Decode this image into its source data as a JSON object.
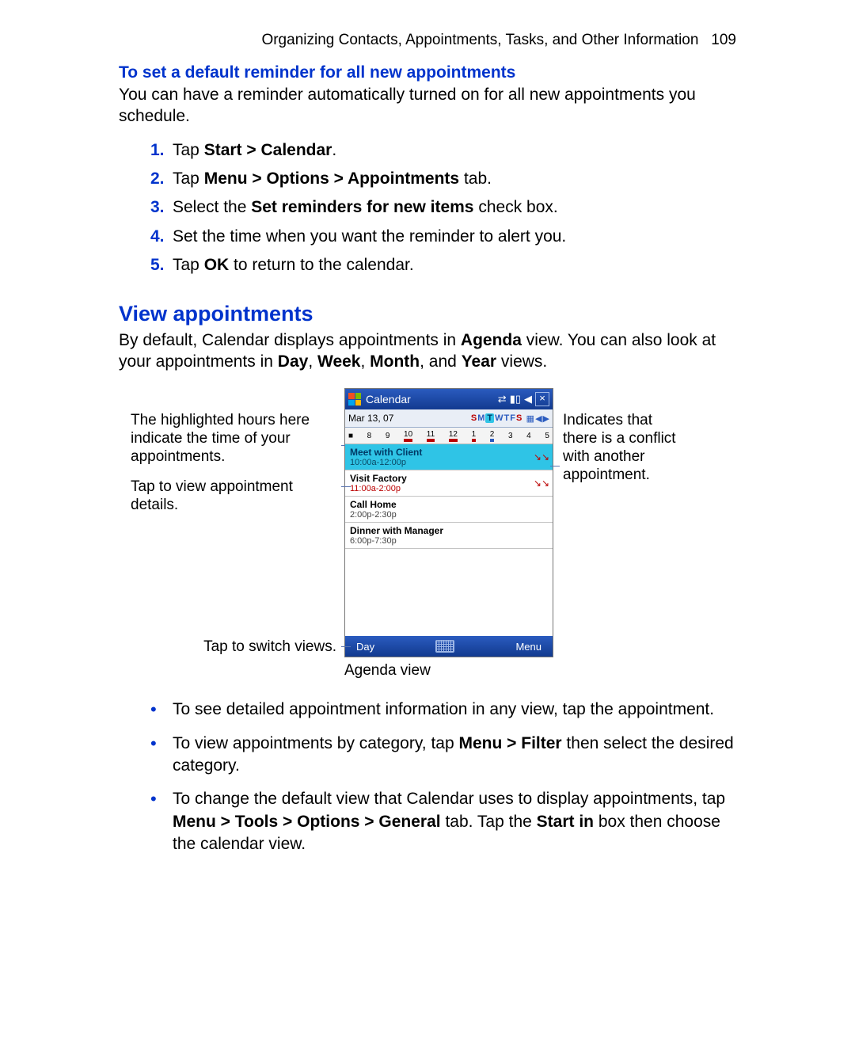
{
  "running_head": {
    "title": "Organizing Contacts, Appointments, Tasks, and Other Information",
    "page_no": "109"
  },
  "section1": {
    "title": "To set a default reminder for all new appointments",
    "intro": "You can have a reminder automatically turned on for all new appointments you schedule.",
    "steps": [
      {
        "n": "1.",
        "pre": "Tap ",
        "bold": "Start > Calendar",
        "post": "."
      },
      {
        "n": "2.",
        "pre": "Tap ",
        "bold": "Menu > Options > Appointments",
        "post": " tab."
      },
      {
        "n": "3.",
        "pre": "Select the ",
        "bold": "Set reminders for new items",
        "post": " check box."
      },
      {
        "n": "4.",
        "plain": "Set the time when you want the reminder to alert you."
      },
      {
        "n": "5.",
        "pre": "Tap ",
        "bold": "OK",
        "post": " to return to the calendar."
      }
    ]
  },
  "section2": {
    "title": "View appointments",
    "intro_a": "By default, Calendar displays appointments in ",
    "intro_b": "Agenda",
    "intro_c": " view. You can also look at your appointments in ",
    "intro_d": "Day",
    "intro_e": ", ",
    "intro_f": "Week",
    "intro_g": ", ",
    "intro_h": "Month",
    "intro_i": ", and ",
    "intro_j": "Year",
    "intro_k": " views."
  },
  "callouts": {
    "left1": "The highlighted hours here indicate the time of your appointments.",
    "left2": "Tap to view appointment details.",
    "left3": "Tap to switch views.",
    "right1": "Indicates that there is a conflict with another appointment."
  },
  "device": {
    "title": "Calendar",
    "date": "Mar 13, 07",
    "dows": [
      "S",
      "M",
      "T",
      "W",
      "T",
      "F",
      "S"
    ],
    "hours": [
      "8",
      "9",
      "10",
      "11",
      "12",
      "1",
      "2",
      "3",
      "4",
      "5"
    ],
    "appointments": [
      {
        "title": "Meet with Client",
        "time": "10:00a-12:00p",
        "active": true,
        "conflict": true
      },
      {
        "title": "Visit Factory",
        "time": "11:00a-2:00p",
        "active": false,
        "conflict": true
      },
      {
        "title": "Call Home",
        "time": "2:00p-2:30p",
        "active": false,
        "conflict": false
      },
      {
        "title": "Dinner with Manager",
        "time": "6:00p-7:30p",
        "active": false,
        "conflict": false
      }
    ],
    "soft_left": "Day",
    "soft_right": "Menu",
    "caption": "Agenda view"
  },
  "bullets": {
    "b1": "To see detailed appointment information in any view, tap the appointment.",
    "b2_a": "To view appointments by category, tap ",
    "b2_b": "Menu > Filter",
    "b2_c": " then select the desired category.",
    "b3_a": "To change the default view that Calendar uses to display appointments, tap ",
    "b3_b": "Menu > Tools > Options > General",
    "b3_c": " tab. Tap the ",
    "b3_d": "Start in",
    "b3_e": " box then choose the calendar view."
  }
}
